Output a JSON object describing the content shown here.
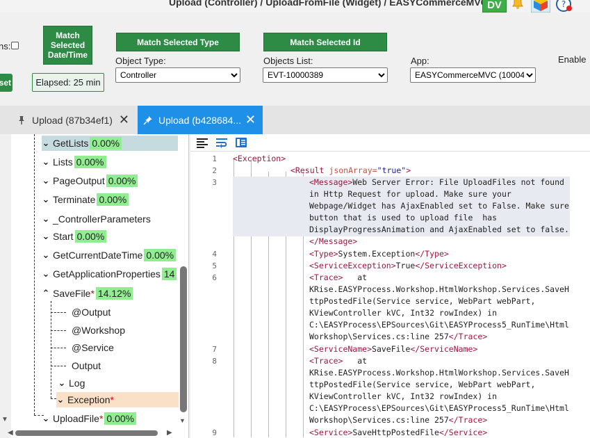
{
  "window": {
    "title": "Upload (Controller) / UploadFromFile (Widget) / EASYCommerceMVC",
    "user_badge": "DV",
    "icons": [
      "bell-icon",
      "cube-icon",
      "help-icon"
    ]
  },
  "toolbar": {
    "ms_label": "ns:",
    "match_datetime_label": "Match Selected Date/Time",
    "match_type_label": "Match Selected Type",
    "match_id_label": "Match Selected Id",
    "reset_label": "set",
    "elapsed": "Elapsed: 25 min",
    "object_type_label": "Object Type:",
    "object_type_value": "Controller",
    "objects_list_label": "Objects List:",
    "objects_list_value": "EVT-10000389",
    "app_label": "App:",
    "app_value": "EASYCommerceMVC (10004",
    "enable_label": "Enable"
  },
  "tabs": [
    {
      "label": "Upload (87b34ef1)",
      "active": false
    },
    {
      "label": "Upload (b428684...",
      "active": true
    }
  ],
  "tree": {
    "items": [
      {
        "label": "GetLists",
        "pct": "0.00%",
        "state": "expanded",
        "selected": true
      },
      {
        "label": "Lists",
        "pct": "0.00%",
        "state": "expanded"
      },
      {
        "label": "PageOutput",
        "pct": "0.00%",
        "state": "expanded"
      },
      {
        "label": "Terminate",
        "pct": "0.00%",
        "state": "expanded"
      },
      {
        "label": "_ControllerParameters",
        "pct": "",
        "state": "expanded"
      },
      {
        "label": "Start",
        "pct": "0.00%",
        "state": "expanded"
      },
      {
        "label": "GetCurrentDateTime",
        "pct": "0.00%",
        "state": "expanded"
      },
      {
        "label": "GetApplicationProperties",
        "pct": "14",
        "state": "expanded"
      },
      {
        "label": "SaveFile",
        "pct": "14.12%",
        "state": "collapsed",
        "star": "*"
      },
      {
        "label": "@Output",
        "pct": "",
        "state": "none"
      },
      {
        "label": "@Workshop",
        "pct": "",
        "state": "none"
      },
      {
        "label": "@Service",
        "pct": "",
        "state": "none"
      },
      {
        "label": "Output",
        "pct": "",
        "state": "none"
      },
      {
        "label": "Log",
        "pct": "",
        "state": "expanded"
      },
      {
        "label": "Exception",
        "pct": "",
        "state": "expanded",
        "star": "*",
        "highlight": true
      },
      {
        "label": "UploadFile",
        "pct": "0.00%",
        "state": "expanded",
        "star": "*"
      }
    ]
  },
  "code": {
    "line_numbers": [
      "1",
      "2",
      "3",
      "4",
      "5",
      "6",
      "7",
      "8",
      "9"
    ],
    "l1_tag": "<Exception>",
    "l2_tag_open": "<Result ",
    "l2_attr": "jsonArray=",
    "l2_val": "\"true\"",
    "l2_close": ">",
    "l3_open": "<Message>",
    "l3_text1": "Web Server Error: File UploadFiles not found",
    "l3_text2": "in Http Request for upload. Make sure your",
    "l3_text3": "Webpage/Widget has AjaxEnabled set to False. Make sure",
    "l3_text4": "button that is used to upload file  has",
    "l3_text5": "DisplayProgressAnimation and AjaxEnabled set to false.",
    "l3_close": "</Message>",
    "l4_open": "<Type>",
    "l4_text": "System.Exception",
    "l4_close": "</Type>",
    "l5_open": "<ServiceException>",
    "l5_text": "True",
    "l5_close": "</ServiceException>",
    "l6_open": "<Trace>",
    "l6_text1": "   at",
    "l6_text2": "KRise.EASYProcess.Workshop.HtmlWorkshop.Services.SaveH",
    "l6_text3": "ttpPostedFile(Service service, WebPart webPart,",
    "l6_text4": "KViewController kVC, Int32 rowIndex) in",
    "l6_text5": "C:\\EASYProcess\\EPSources\\Git\\EASYProcess5_RunTime\\Html",
    "l6_text6": "Workshop\\Services.cs:line 257",
    "l6_close": "</Trace>",
    "l7_open": "<ServiceName>",
    "l7_text": "SaveFile",
    "l7_close": "</ServiceName>",
    "l8_open": "<Trace>",
    "l8_text1": "   at",
    "l8_text2": "KRise.EASYProcess.Workshop.HtmlWorkshop.Services.SaveH",
    "l8_text3": "ttpPostedFile(Service service, WebPart webPart,",
    "l8_text4": "KViewController kVC, Int32 rowIndex) in",
    "l8_text5": "C:\\EASYProcess\\EPSources\\Git\\EASYProcess5_RunTime\\Html",
    "l8_text6": "Workshop\\Services.cs:line 257",
    "l8_close": "</Trace>",
    "l9_open": "<Service>",
    "l9_text": "SaveHttpPostedFile",
    "l9_close": "</Service>"
  },
  "colors": {
    "accent_green": "#2e8b46",
    "tab_active": "#1e90e8",
    "pct_bg": "#90ee90",
    "tag": "#a0153e"
  }
}
